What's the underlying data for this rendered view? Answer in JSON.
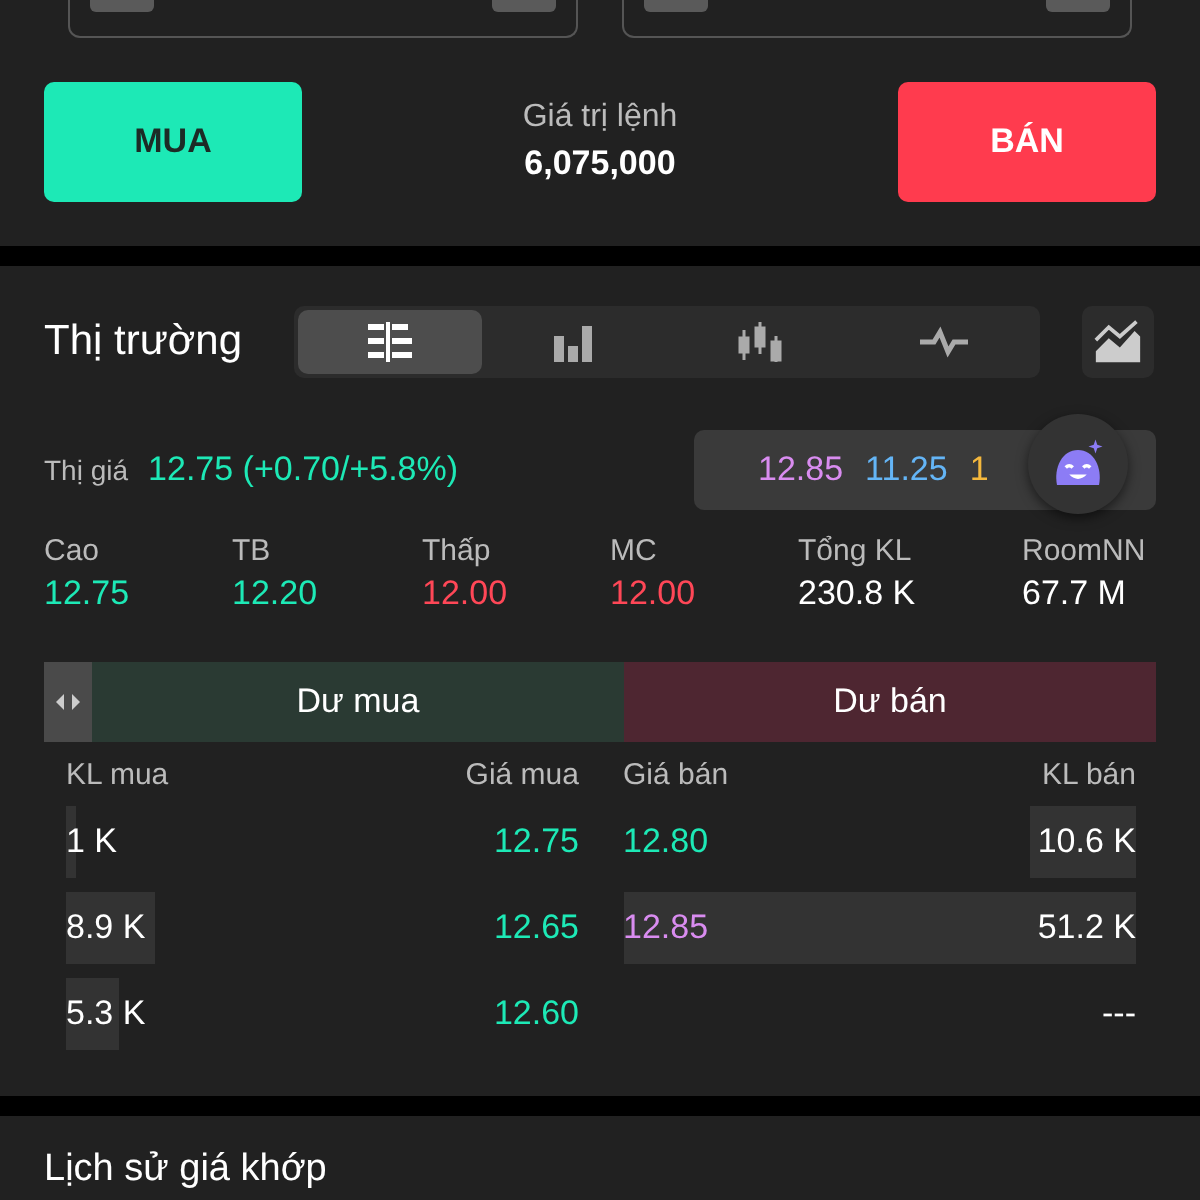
{
  "order": {
    "buy_label": "MUA",
    "value_label": "Giá trị lệnh",
    "value": "6,075,000",
    "sell_label": "BÁN"
  },
  "market": {
    "title": "Thị trường",
    "chart_tabs": [
      {
        "kind": "depth",
        "selected": true
      },
      {
        "kind": "bars",
        "selected": false
      },
      {
        "kind": "candles",
        "selected": false
      },
      {
        "kind": "line",
        "selected": false
      }
    ],
    "price_label": "Thị giá",
    "price": {
      "text": "12.75 (+0.70/+5.8%)",
      "color": "#1de9b6"
    },
    "ref_prices": [
      {
        "text": "12.85",
        "color": "#d98cf0"
      },
      {
        "text": "11.25",
        "color": "#64b5f6"
      },
      {
        "text": "1",
        "color": "#f5b83d"
      }
    ],
    "stats": [
      {
        "label": "Cao",
        "value": "12.75",
        "color": "#1de9b6"
      },
      {
        "label": "TB",
        "value": "12.20",
        "color": "#1de9b6"
      },
      {
        "label": "Thấp",
        "value": "12.00",
        "color": "#ff4757"
      },
      {
        "label": "MC",
        "value": "12.00",
        "color": "#ff4757"
      },
      {
        "label": "Tổng KL",
        "value": "230.8 K",
        "color": "#ffffff"
      },
      {
        "label": "RoomNN",
        "value": "67.7 M",
        "color": "#ffffff"
      }
    ],
    "book_tabs": [
      "Dư mua",
      "Dư bán"
    ],
    "columns": [
      "KL mua",
      "Giá mua",
      "Giá bán",
      "KL bán"
    ],
    "rows": [
      {
        "buy_volume": "1 K",
        "buy_price": {
          "text": "12.75",
          "color": "#1de9b6"
        },
        "sell_price": {
          "text": "12.80",
          "color": "#1de9b6"
        },
        "sell_volume": "10.6 K"
      },
      {
        "buy_volume": "8.9 K",
        "buy_price": {
          "text": "12.65",
          "color": "#1de9b6"
        },
        "sell_price": {
          "text": "12.85",
          "color": "#d98cf0"
        },
        "sell_volume": "51.2 K"
      },
      {
        "buy_volume": "5.3 K",
        "buy_price": {
          "text": "12.60",
          "color": "#1de9b6"
        },
        "sell_volume": "---"
      }
    ]
  },
  "history": {
    "title": "Lịch sử giá khớp"
  }
}
